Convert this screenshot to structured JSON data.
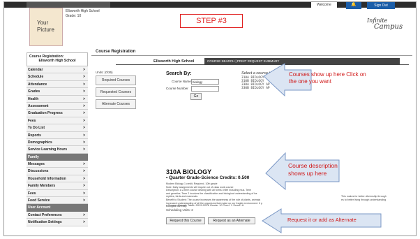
{
  "header": {
    "welcome": "Welcome",
    "signout": "Sign Out",
    "photo_text": "Your Picture",
    "school_name": "Ellsworth High School",
    "grade": "Grade: 10",
    "step_label": "STEP #3",
    "logo_line1": "Infinite",
    "logo_line2": "Campus"
  },
  "sidebar": {
    "head1": "Course Registration:",
    "head2": "Ellsworth High School",
    "items": [
      "Calendar",
      "Schedule",
      "Attendance",
      "Grades",
      "Health",
      "Assessment",
      "Graduation Progress",
      "Fees",
      "To Do List",
      "Reports",
      "Demographics",
      "Service Learning Hours"
    ],
    "section_family": "Family",
    "family_items": [
      "Messages",
      "Discussions",
      "Household Information",
      "Family Members",
      "Fees",
      "Food Service"
    ],
    "section_user": "User Account",
    "user_items": [
      "Contact Preferences",
      "Notification Settings"
    ]
  },
  "main": {
    "title": "Course Registration",
    "school_tab": "Ellsworth High School",
    "tab_bar": "COURSE SEARCH | PRINT REQUEST SUMMARY",
    "units": "Units: (0/36)",
    "left_buttons": [
      "Required Courses",
      "Requested Courses",
      "Alternate Courses"
    ],
    "search_by": "Search By:",
    "course_name_label": "Course Name",
    "course_name_value": "biology",
    "course_number_label": "Course Number",
    "go": "Go",
    "select_hint": "Select a course to view",
    "results": [
      "310A BIOLOGY",
      "310B BIOLOGY",
      "330A BIOLOGY AP",
      "330B BIOLOGY AP"
    ]
  },
  "callouts": {
    "one": "Courses show up here Click on the one you want",
    "two": "Course description shows up here",
    "three": "Request it or add as Alternate"
  },
  "course": {
    "code": "310A BIOLOGY",
    "credits": "• Quarter Grade-Science Credits: 0.500",
    "desc1": "Modern Biology 1 credit, Required, 10th grade",
    "desc2": "Note: Daily assignments will require out of class work course",
    "desc3": "Description: A 2-term course dealing with all forms of life including mus. Term",
    "desc4": "and genetics. Term 2 involves the classification and biological understanding of ba",
    "desc5": "reptiles, birds and mammals.",
    "desc6": "Benefit to Student: The course increases the awareness of the role of plants, animals",
    "desc7": "increased understanding of all the organisms that make up our fragile environment. It p",
    "desc8": "biological diversity.",
    "desc_right1": "This makes for better citizenship through",
    "desc_right2": "es to better living through understanding",
    "taken": "• Course Already Taken 2015-2016 Grade: 10 Term: 1 Score: A",
    "scheduling": "Scheduling Units: 2",
    "request_btn": "Request this Course",
    "alternate_btn": "Request as an Alternate"
  }
}
